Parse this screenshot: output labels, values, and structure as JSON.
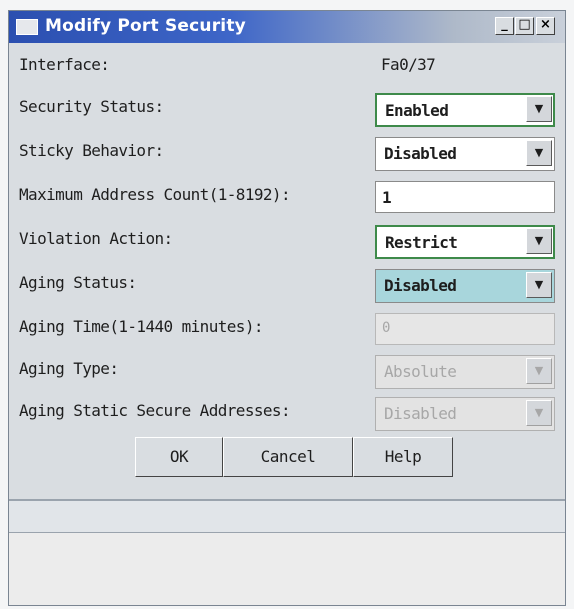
{
  "window": {
    "title": "Modify Port Security",
    "controls": {
      "minimize": "_",
      "maximize": "□",
      "close": "×"
    }
  },
  "form": {
    "interface": {
      "label": "Interface:",
      "value": "Fa0/37"
    },
    "security_status": {
      "label": "Security Status:",
      "value": "Enabled"
    },
    "sticky_behavior": {
      "label": "Sticky Behavior:",
      "value": "Disabled"
    },
    "max_address_count": {
      "label": "Maximum Address Count(1-8192):",
      "value": "1"
    },
    "violation_action": {
      "label": "Violation Action:",
      "value": "Restrict"
    },
    "aging_status": {
      "label": "Aging Status:",
      "value": "Disabled"
    },
    "aging_time": {
      "label": "Aging Time(1-1440 minutes):",
      "value": "0"
    },
    "aging_type": {
      "label": "Aging Type:",
      "value": "Absolute"
    },
    "aging_static": {
      "label": "Aging Static Secure Addresses:",
      "value": "Disabled"
    }
  },
  "buttons": {
    "ok": "OK",
    "cancel": "Cancel",
    "help": "Help"
  },
  "icons": {
    "dropdown": "chevron-down-icon",
    "window": "window-icon"
  },
  "colors": {
    "titlebar": "#2b4fb0",
    "focus_border": "#3e8a4a",
    "highlight": "#a8d6dc"
  }
}
